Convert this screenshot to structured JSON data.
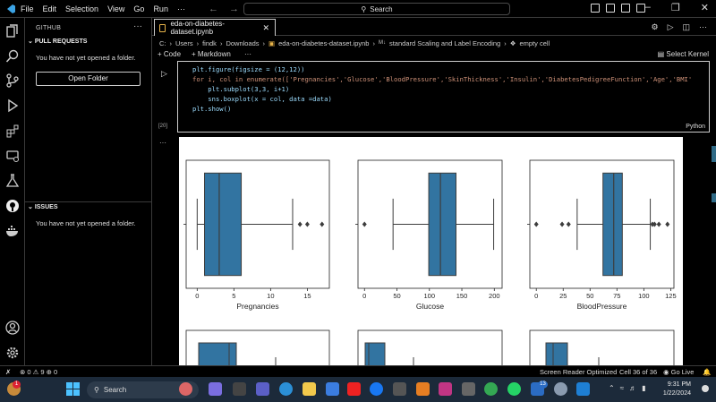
{
  "titlebar": {
    "menu": [
      "File",
      "Edit",
      "Selection",
      "View",
      "Go",
      "Run",
      "···"
    ],
    "search": "Search"
  },
  "sidebar": {
    "title": "GITHUB",
    "pull_requests": {
      "header": "PULL REQUESTS",
      "message": "You have not yet opened a folder.",
      "button": "Open Folder"
    },
    "issues": {
      "header": "ISSUES",
      "message": "You have not yet opened a folder."
    }
  },
  "editor": {
    "tab_label": "eda-on-diabetes-dataset.ipynb",
    "breadcrumb": [
      "C:",
      "Users",
      "findk",
      "Downloads",
      "eda-on-diabetes-dataset.ipynb",
      "standard Scaling and Label Encoding",
      "empty cell"
    ],
    "toolbar": {
      "add_code": "+ Code",
      "add_markdown": "+ Markdown",
      "more": "···",
      "select_kernel": "Select Kernel"
    },
    "cell": {
      "exec_count": "[20]",
      "language": "Python",
      "code_lines": [
        "plt.figure(figsize = (12,12))",
        "for i, col in enumerate(['Pregnancies','Glucose','BloodPressure','SkinThickness','Insulin','DiabetesPedigreeFunction','Age','BMI'",
        "    plt.subplot(3,3, i+1)",
        "    sns.boxplot(x = col, data =data)",
        "plt.show()"
      ]
    }
  },
  "chart_data": [
    {
      "type": "boxplot",
      "xlabel": "Pregnancies",
      "xlim": [
        -1.5,
        18
      ],
      "ticks": [
        0,
        5,
        10,
        15
      ],
      "whisker_low": 0,
      "q1": 1,
      "median": 3,
      "q3": 6,
      "whisker_high": 13,
      "outliers": [
        14,
        15,
        17
      ]
    },
    {
      "type": "boxplot",
      "xlabel": "Glucose",
      "xlim": [
        -10,
        212
      ],
      "ticks": [
        0,
        50,
        100,
        150,
        200
      ],
      "whisker_low": 44,
      "q1": 99,
      "median": 117,
      "q3": 141,
      "whisker_high": 199,
      "outliers": [
        0
      ]
    },
    {
      "type": "boxplot",
      "xlabel": "BloodPressure",
      "xlim": [
        -6,
        128
      ],
      "ticks": [
        0,
        25,
        50,
        75,
        100,
        125
      ],
      "whisker_low": 38,
      "q1": 62,
      "median": 72,
      "q3": 80,
      "whisker_high": 106,
      "outliers": [
        0,
        24,
        30,
        108,
        110,
        114,
        122
      ]
    }
  ],
  "statusbar": {
    "left": "⊗ 0 ⚠ 9   ⊕ 0",
    "screen_reader": "Screen Reader Optimized",
    "cell": "Cell 36 of 36",
    "golive": "◉ Go Live"
  },
  "taskbar": {
    "search": "Search",
    "time": "9:31 PM",
    "date": "1/22/2024",
    "notification_count": "1",
    "teams_badge": "13"
  }
}
